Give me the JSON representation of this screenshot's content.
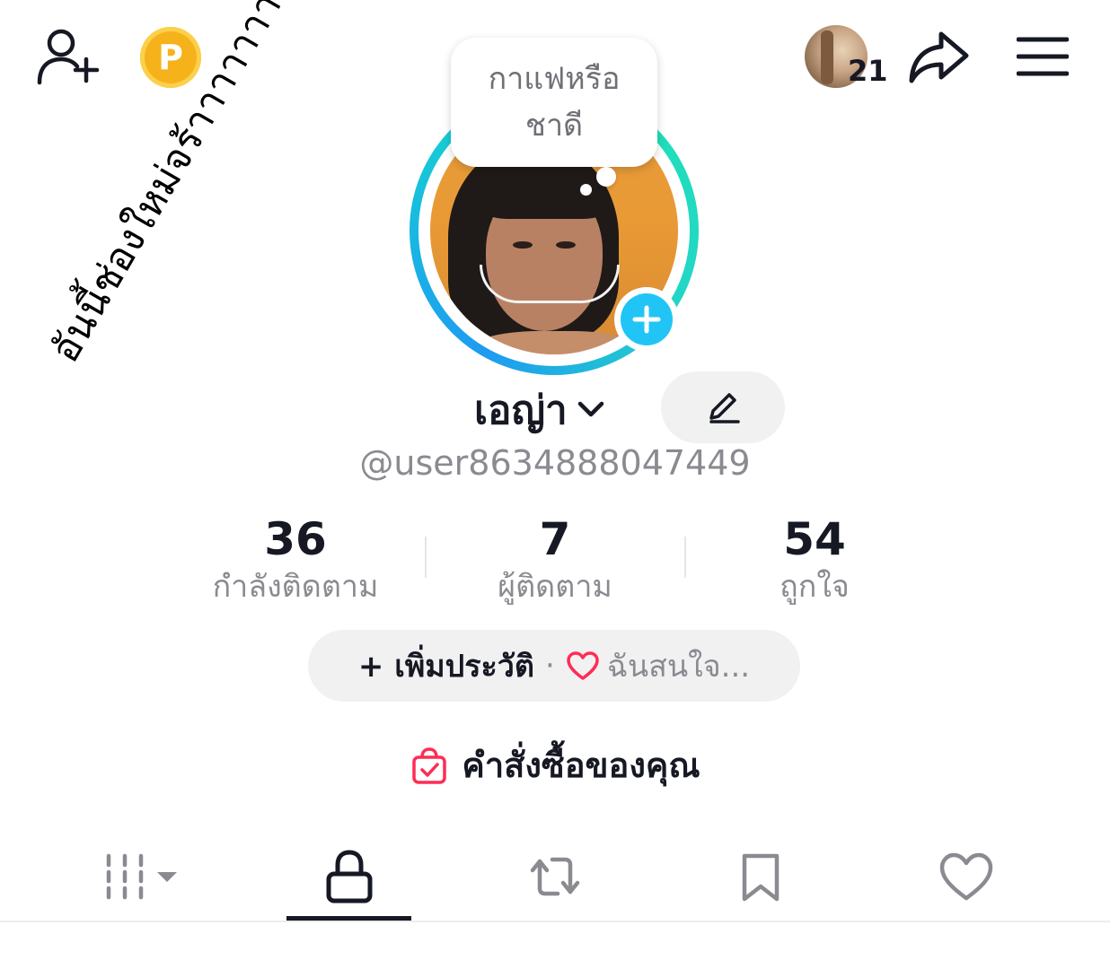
{
  "top_bar": {
    "add_friend_icon": "add-user-icon",
    "points_label": "P",
    "mini_avatar_count": "21",
    "share_icon": "share-icon",
    "menu_icon": "menu-icon"
  },
  "profile": {
    "thought_bubble": [
      "กาแฟหรือ",
      "ชาดี"
    ],
    "display_name": "เอญ่า",
    "username": "@user8634888047449"
  },
  "stats": [
    {
      "value": "36",
      "label": "กำลังติดตาม"
    },
    {
      "value": "7",
      "label": "ผู้ติดตาม"
    },
    {
      "value": "54",
      "label": "ถูกใจ"
    }
  ],
  "bio": {
    "add_label": "+ เพิ่มประวัติ",
    "separator": "·",
    "interest_label": "ฉันสนใจ..."
  },
  "orders": {
    "label": "คำสั่งซื้อของคุณ"
  },
  "tabs": [
    {
      "name": "videos-grid",
      "icon": "grid-icon",
      "selected": false
    },
    {
      "name": "private",
      "icon": "lock-icon",
      "selected": true
    },
    {
      "name": "reposts",
      "icon": "repost-icon",
      "selected": false
    },
    {
      "name": "favorites",
      "icon": "bookmark-icon",
      "selected": false
    },
    {
      "name": "liked",
      "icon": "heart-icon",
      "selected": false
    }
  ],
  "overlay_caption": "อันนี้ช่องใหม่จร้าาาาาาาาา",
  "colors": {
    "accent_blue": "#20c5f5",
    "points_gold": "#f6b21a",
    "heart_pink": "#fe2c55",
    "text_primary": "#161823",
    "text_secondary": "#8a8b91"
  }
}
